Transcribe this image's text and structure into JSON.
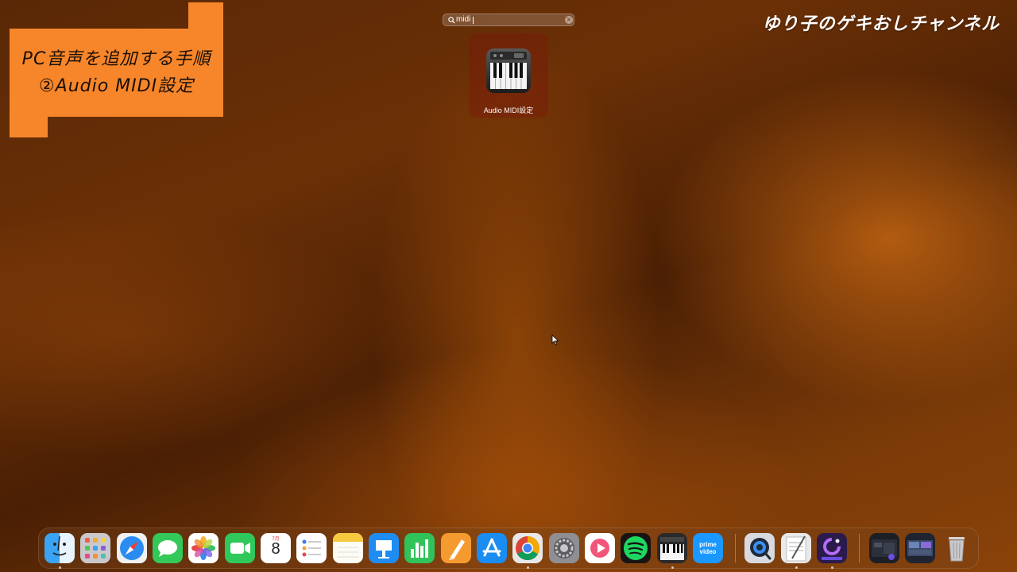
{
  "caption": {
    "line1": "PC音声を追加する手順",
    "line2": "②Audio MIDI設定"
  },
  "channel_name": "ゆり子のゲキおしチャンネル",
  "launchpad": {
    "search_value": "midi",
    "result_label": "Audio MIDI設定"
  },
  "dock": {
    "calendar_month": "7月",
    "calendar_day": "8",
    "prime_video_text_1": "prime",
    "prime_video_text_2": "video",
    "apps": [
      "finder",
      "launchpad",
      "safari",
      "messages",
      "photos",
      "facetime",
      "calendar",
      "reminders",
      "notes",
      "keynote",
      "numbers",
      "pages",
      "app-store",
      "chrome",
      "system-settings",
      "vllo",
      "spotify",
      "audio-midi-setup",
      "prime-video",
      "quicktime",
      "textedit",
      "app",
      "window-1",
      "window-2",
      "trash"
    ]
  },
  "colors": {
    "caption_bg": "#f7862a",
    "wallpaper": "#6b3006"
  }
}
